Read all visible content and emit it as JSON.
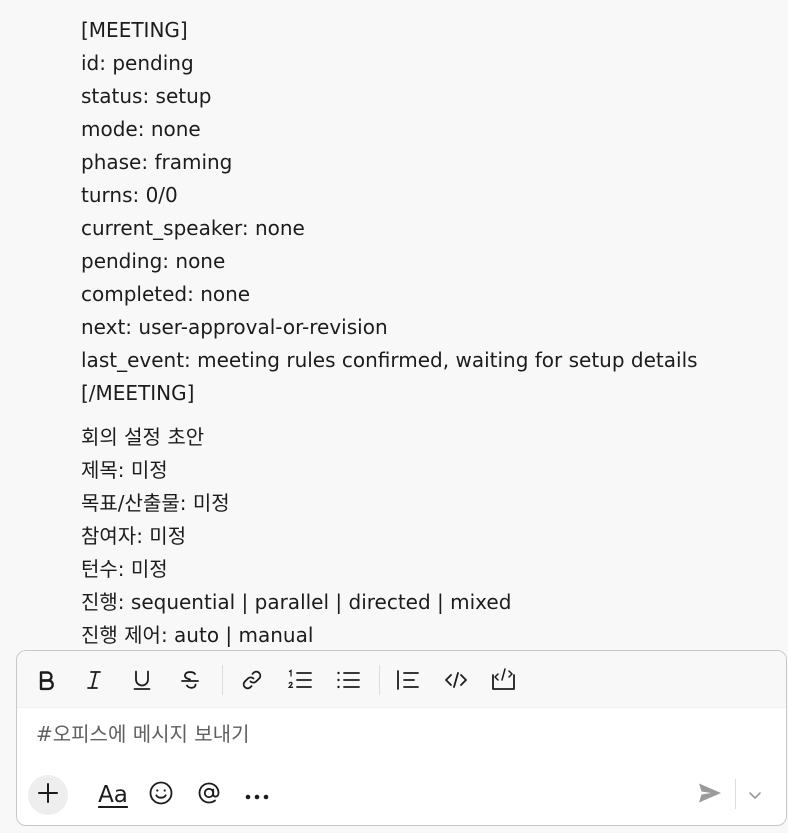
{
  "message": {
    "meeting_block": [
      "[MEETING]",
      "id: pending",
      "status: setup",
      "mode: none",
      "phase: framing",
      "turns: 0/0",
      "current_speaker: none",
      "pending: none",
      "completed: none",
      "next: user-approval-or-revision",
      "last_event: meeting rules confirmed, waiting for setup details",
      "[/MEETING]"
    ],
    "draft_block": [
      "회의 설정 초안",
      "제목: 미정",
      "목표/산출물: 미정",
      "참여자: 미정",
      "턴수: 미정",
      "진행: sequential | parallel | directed | mixed",
      "진행 제어: auto | manual"
    ]
  },
  "composer": {
    "placeholder": "#오피스에 메시지 보내기",
    "value": "",
    "format_toolbar": [
      "bold-icon",
      "italic-icon",
      "underline-icon",
      "strikethrough-icon",
      "link-icon",
      "ordered-list-icon",
      "bulleted-list-icon",
      "blockquote-icon",
      "code-icon",
      "code-block-icon"
    ],
    "bottom_toolbar": [
      "plus-icon",
      "text-format-icon",
      "emoji-icon",
      "mention-icon",
      "more-icon",
      "send-icon",
      "chevron-down-icon"
    ],
    "format_label": "Aa"
  },
  "colors": {
    "background": "#f8f8f8",
    "text": "#1d1c1d",
    "icon": "#1d1c1d",
    "muted_icon": "#9a9a9a",
    "border": "#c8c8c8"
  }
}
